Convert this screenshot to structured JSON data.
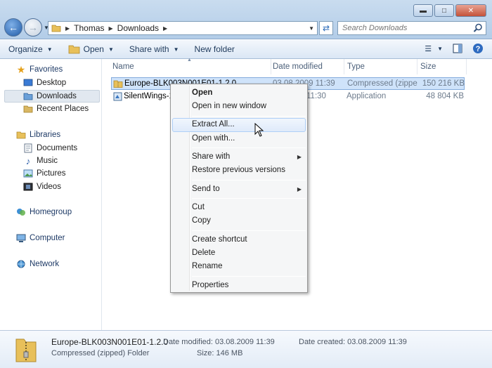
{
  "window": {
    "minimize_icon": "minimize-icon",
    "maximize_icon": "maximize-icon",
    "close_icon": "close-icon"
  },
  "address": {
    "crumbs": [
      "Thomas",
      "Downloads"
    ],
    "search_placeholder": "Search Downloads"
  },
  "toolbar": {
    "organize": "Organize",
    "open": "Open",
    "share_with": "Share with",
    "new_folder": "New folder"
  },
  "navpane": {
    "favorites": "Favorites",
    "desktop": "Desktop",
    "downloads": "Downloads",
    "recent_places": "Recent Places",
    "libraries": "Libraries",
    "documents": "Documents",
    "music": "Music",
    "pictures": "Pictures",
    "videos": "Videos",
    "homegroup": "Homegroup",
    "computer": "Computer",
    "network": "Network"
  },
  "columns": {
    "name": "Name",
    "date_modified": "Date modified",
    "type": "Type",
    "size": "Size"
  },
  "files": [
    {
      "name": "Europe-BLK003N001E01-1.2.0",
      "date": "03.08.2009 11:39",
      "type": "Compressed (zippe...",
      "size": "150 216 KB"
    },
    {
      "name": "SilentWings-1",
      "date": "11:30",
      "type": "Application",
      "size": "48 804 KB"
    }
  ],
  "context_menu": {
    "open": "Open",
    "open_new_window": "Open in new window",
    "extract_all": "Extract All...",
    "open_with": "Open with...",
    "share_with": "Share with",
    "restore_previous": "Restore previous versions",
    "send_to": "Send to",
    "cut": "Cut",
    "copy": "Copy",
    "create_shortcut": "Create shortcut",
    "delete": "Delete",
    "rename": "Rename",
    "properties": "Properties"
  },
  "details": {
    "name": "Europe-BLK003N001E01-1.2.0",
    "type": "Compressed (zipped) Folder",
    "date_modified": "Date modified: 03.08.2009 11:39",
    "size": "Size: 146 MB",
    "date_created": "Date created: 03.08.2009 11:39"
  },
  "colors": {
    "selection": "#cfe3fa",
    "menu_highlight": "#dfeafa",
    "titlebar": "#b3cde8"
  }
}
